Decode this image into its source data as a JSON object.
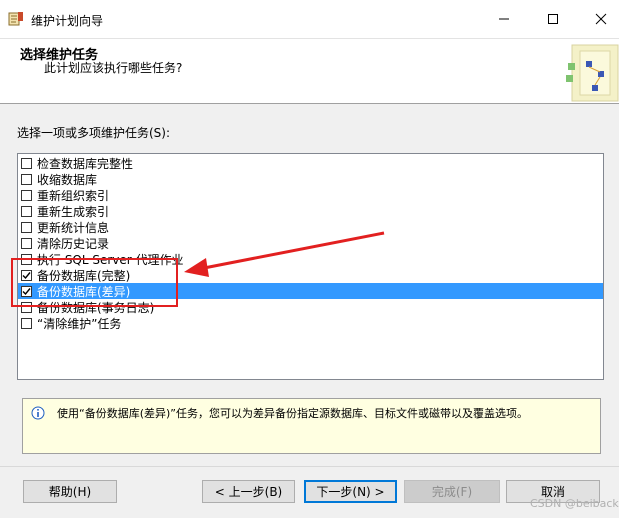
{
  "window": {
    "title": "维护计划向导",
    "icons": {
      "app": "wizard-app-icon",
      "minimize": "minimize-icon",
      "maximize": "maximize-icon",
      "close": "close-icon"
    }
  },
  "header": {
    "title": "选择维护任务",
    "subtitle": "此计划应该执行哪些任务?"
  },
  "tasks_label": "选择一项或多项维护任务(S):",
  "tasks": [
    {
      "label": "检查数据库完整性",
      "checked": false,
      "selected": false
    },
    {
      "label": "收缩数据库",
      "checked": false,
      "selected": false
    },
    {
      "label": "重新组织索引",
      "checked": false,
      "selected": false
    },
    {
      "label": "重新生成索引",
      "checked": false,
      "selected": false
    },
    {
      "label": "更新统计信息",
      "checked": false,
      "selected": false
    },
    {
      "label": "清除历史记录",
      "checked": false,
      "selected": false
    },
    {
      "label": "执行 SQL Server 代理作业",
      "checked": false,
      "selected": false
    },
    {
      "label": "备份数据库(完整)",
      "checked": true,
      "selected": false
    },
    {
      "label": "备份数据库(差异)",
      "checked": true,
      "selected": true
    },
    {
      "label": "备份数据库(事务日志)",
      "checked": false,
      "selected": false
    },
    {
      "label": "“清除维护”任务",
      "checked": false,
      "selected": false
    }
  ],
  "info": {
    "icon": "info-icon",
    "text": "使用“备份数据库(差异)”任务，您可以为差异备份指定源数据库、目标文件或磁带以及覆盖选项。"
  },
  "buttons": {
    "help": "帮助(H)",
    "back": "< 上一步(B)",
    "next": "下一步(N) >",
    "finish": "完成(F)",
    "cancel": "取消"
  },
  "watermark": "CSDN @beiback",
  "colors": {
    "selection": "#3399ff",
    "annotation": "#e22020",
    "info_bg": "#ffffe1"
  }
}
